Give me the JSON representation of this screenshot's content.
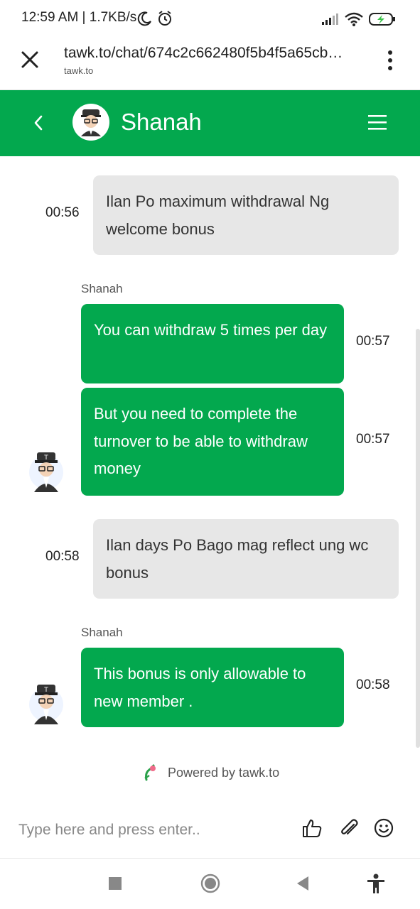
{
  "status_bar": {
    "time_speed": "12:59 AM | 1.7KB/s",
    "icons": [
      "moon-icon",
      "alarm-icon",
      "signal-icon",
      "wifi-icon",
      "battery-charging-icon"
    ]
  },
  "browser": {
    "url": "tawk.to/chat/674c2c662480f5b4f5a65cb…",
    "domain": "tawk.to"
  },
  "header": {
    "agent_name": "Shanah"
  },
  "messages": [
    {
      "from": "visitor",
      "text": "Ilan Po maximum withdrawal Ng welcome bonus",
      "time": "00:56"
    },
    {
      "from": "agent",
      "sender": "Shanah",
      "text": "You can withdraw 5 times per day",
      "time": "00:57"
    },
    {
      "from": "agent",
      "text": "But you need to complete the turnover to be able to withdraw money",
      "time": "00:57"
    },
    {
      "from": "visitor",
      "text": "Ilan days Po Bago mag reflect ung wc bonus",
      "time": "00:58"
    },
    {
      "from": "agent",
      "sender": "Shanah",
      "text": "This bonus is only allowable to new member .",
      "time": "00:58"
    }
  ],
  "footer": {
    "powered_by": "Powered by tawk.to"
  },
  "composer": {
    "placeholder": "Type here and press enter.."
  },
  "colors": {
    "brand_green": "#03a84e",
    "visitor_bubble": "#e7e7e7"
  }
}
